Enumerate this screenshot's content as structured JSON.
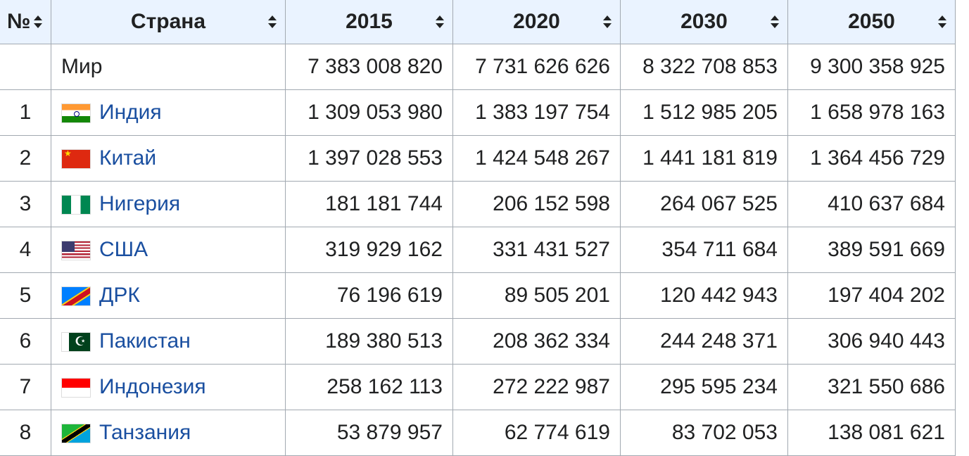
{
  "headers": {
    "rank": "№",
    "country": "Страна",
    "y2015": "2015",
    "y2020": "2020",
    "y2030": "2030",
    "y2050": "2050"
  },
  "world": {
    "name": "Мир",
    "v2015": "7 383 008 820",
    "v2020": "7 731 626 626",
    "v2030": "8 322 708 853",
    "v2050": "9 300 358 925"
  },
  "rows": [
    {
      "rank": "1",
      "name": "Индия",
      "flag": "india-flag",
      "v2015": "1 309 053 980",
      "v2020": "1 383 197 754",
      "v2030": "1 512 985 205",
      "v2050": "1 658 978 163"
    },
    {
      "rank": "2",
      "name": "Китай",
      "flag": "china-flag",
      "v2015": "1 397 028 553",
      "v2020": "1 424 548 267",
      "v2030": "1 441 181 819",
      "v2050": "1 364 456 729"
    },
    {
      "rank": "3",
      "name": "Нигерия",
      "flag": "nigeria-flag",
      "v2015": "181 181 744",
      "v2020": "206 152 598",
      "v2030": "264 067 525",
      "v2050": "410 637 684"
    },
    {
      "rank": "4",
      "name": "США",
      "flag": "usa-flag",
      "v2015": "319 929 162",
      "v2020": "331 431 527",
      "v2030": "354 711 684",
      "v2050": "389 591 669"
    },
    {
      "rank": "5",
      "name": "ДРК",
      "flag": "drc-flag",
      "v2015": "76 196 619",
      "v2020": "89 505 201",
      "v2030": "120 442 943",
      "v2050": "197 404 202"
    },
    {
      "rank": "6",
      "name": "Пакистан",
      "flag": "pakistan-flag",
      "v2015": "189 380 513",
      "v2020": "208 362 334",
      "v2030": "244 248 371",
      "v2050": "306 940 443"
    },
    {
      "rank": "7",
      "name": "Индонезия",
      "flag": "indonesia-flag",
      "v2015": "258 162 113",
      "v2020": "272 222 987",
      "v2030": "295 595 234",
      "v2050": "321 550 686"
    },
    {
      "rank": "8",
      "name": "Танзания",
      "flag": "tanzania-flag",
      "v2015": "53 879 957",
      "v2020": "62 774 619",
      "v2030": "83 702 053",
      "v2050": "138 081 621"
    }
  ]
}
